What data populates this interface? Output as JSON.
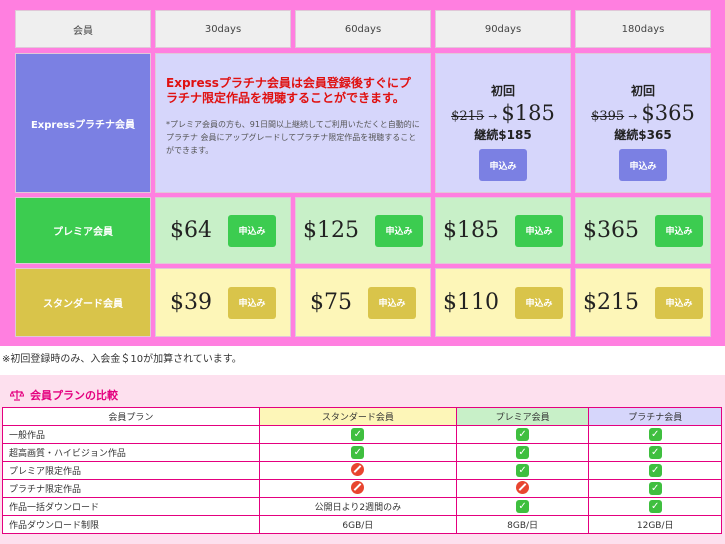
{
  "columns": {
    "member": "会員",
    "d30": "30days",
    "d60": "60days",
    "d90": "90days",
    "d180": "180days"
  },
  "express": {
    "label": "Expressプラチナ会員",
    "headline": "Expressプラチナ会員は会員登録後すぐにプラチナ限定作品を視聴することができます。",
    "note": "*プレミア会員の方も、91日間以上継続してご利用いただくと自動的にプラチナ 会員にアップグレードしてプラチナ限定作品を視聴することができます。",
    "first_label": "初回",
    "arrow": "→",
    "plan90": {
      "old": "$215",
      "new": "$185",
      "continue": "継続$185"
    },
    "plan180": {
      "old": "$395",
      "new": "$365",
      "continue": "継続$365"
    }
  },
  "premier": {
    "label": "プレミア会員",
    "prices": [
      "$64",
      "$125",
      "$185",
      "$365"
    ]
  },
  "standard": {
    "label": "スタンダード会員",
    "prices": [
      "$39",
      "$75",
      "$110",
      "$215"
    ]
  },
  "apply_label": "申込み",
  "footnote": "※初回登録時のみ、入会金＄10が加算されています。",
  "compare": {
    "title": "会員プランの比較",
    "headers": [
      "会員プラン",
      "スタンダード会員",
      "プレミア会員",
      "プラチナ会員"
    ],
    "rows": [
      {
        "feature": "一般作品",
        "values": [
          "check",
          "check",
          "check"
        ]
      },
      {
        "feature": "超高画質・ハイビジョン作品",
        "values": [
          "check",
          "check",
          "check"
        ]
      },
      {
        "feature": "プレミア限定作品",
        "values": [
          "no",
          "check",
          "check"
        ]
      },
      {
        "feature": "プラチナ限定作品",
        "values": [
          "no",
          "no",
          "check"
        ]
      },
      {
        "feature": "作品一括ダウンロード",
        "values": [
          "公開日より2週間のみ",
          "check",
          "check"
        ]
      },
      {
        "feature": "作品ダウンロード制限",
        "values": [
          "6GB/日",
          "8GB/日",
          "12GB/日"
        ]
      }
    ]
  },
  "colors": {
    "frame": "#ff7fe0",
    "express": "#7b80e3",
    "premier": "#3ccc50",
    "standard": "#d9c44a",
    "accent": "#e4007f"
  }
}
